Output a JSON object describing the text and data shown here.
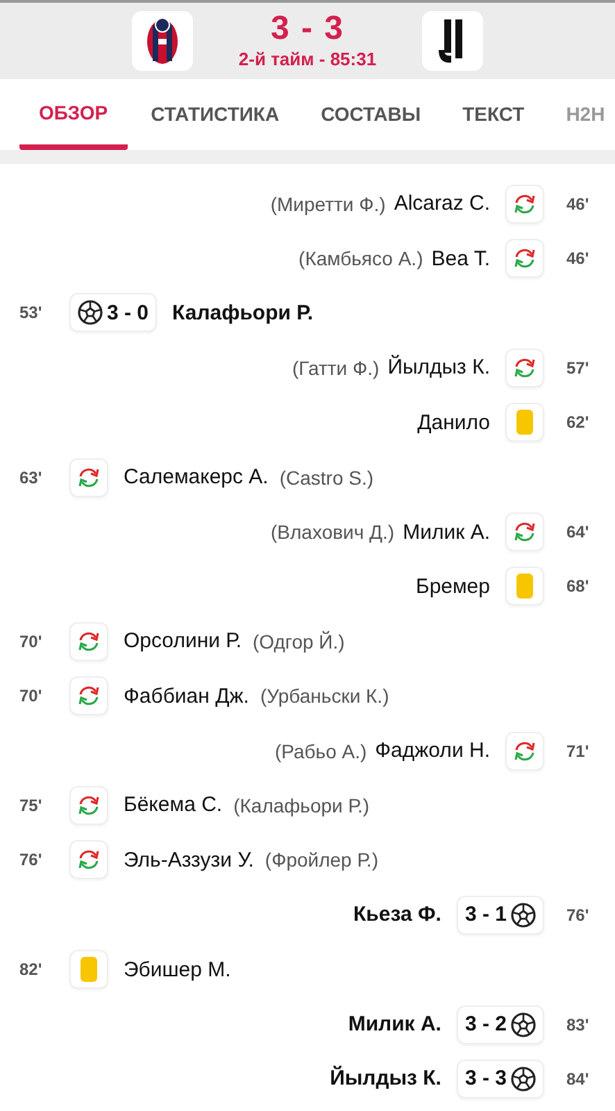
{
  "match": {
    "score": "3 - 3",
    "status": "2-й тайм - 85:31"
  },
  "tabs": [
    {
      "label": "ОБЗОР",
      "selected": true
    },
    {
      "label": "СТАТИСТИКА",
      "selected": false
    },
    {
      "label": "СОСТАВЫ",
      "selected": false
    },
    {
      "label": "ТЕКСТ",
      "selected": false
    },
    {
      "label": "H2H",
      "selected": false
    }
  ],
  "events": [
    {
      "away_team": true,
      "kind": "sub",
      "minute": "46'",
      "player": "Alcaraz C.",
      "other": "(Миретти Ф.)"
    },
    {
      "away_team": true,
      "kind": "sub",
      "minute": "46'",
      "player": "Bea T.",
      "other": "(Камбьясо А.)"
    },
    {
      "away_team": false,
      "kind": "goal",
      "minute": "53'",
      "player": "Калафьори Р.",
      "score": "3 - 0"
    },
    {
      "away_team": true,
      "kind": "sub",
      "minute": "57'",
      "player": "Йылдыз К.",
      "other": "(Гатти Ф.)"
    },
    {
      "away_team": true,
      "kind": "card",
      "minute": "62'",
      "player": "Данило"
    },
    {
      "away_team": false,
      "kind": "sub",
      "minute": "63'",
      "player": "Салемакерс А.",
      "other": "(Castro S.)"
    },
    {
      "away_team": true,
      "kind": "sub",
      "minute": "64'",
      "player": "Милик А.",
      "other": "(Влахович Д.)"
    },
    {
      "away_team": true,
      "kind": "card",
      "minute": "68'",
      "player": "Бремер"
    },
    {
      "away_team": false,
      "kind": "sub",
      "minute": "70'",
      "player": "Орсолини Р.",
      "other": "(Одгор Й.)"
    },
    {
      "away_team": false,
      "kind": "sub",
      "minute": "70'",
      "player": "Фаббиан Дж.",
      "other": "(Урбаньски К.)"
    },
    {
      "away_team": true,
      "kind": "sub",
      "minute": "71'",
      "player": "Фаджоли Н.",
      "other": "(Рабьо А.)"
    },
    {
      "away_team": false,
      "kind": "sub",
      "minute": "75'",
      "player": "Бёкема С.",
      "other": "(Калафьори Р.)"
    },
    {
      "away_team": false,
      "kind": "sub",
      "minute": "76'",
      "player": "Эль-Аззузи У.",
      "other": "(Фройлер Р.)"
    },
    {
      "away_team": true,
      "kind": "goal",
      "minute": "76'",
      "player": "Кьеза Ф.",
      "score": "3 - 1"
    },
    {
      "away_team": false,
      "kind": "card",
      "minute": "82'",
      "player": "Эбишер М."
    },
    {
      "away_team": true,
      "kind": "goal",
      "minute": "83'",
      "player": "Милик А.",
      "score": "3 - 2"
    },
    {
      "away_team": true,
      "kind": "goal",
      "minute": "84'",
      "player": "Йылдыз К.",
      "score": "3 - 3"
    }
  ]
}
